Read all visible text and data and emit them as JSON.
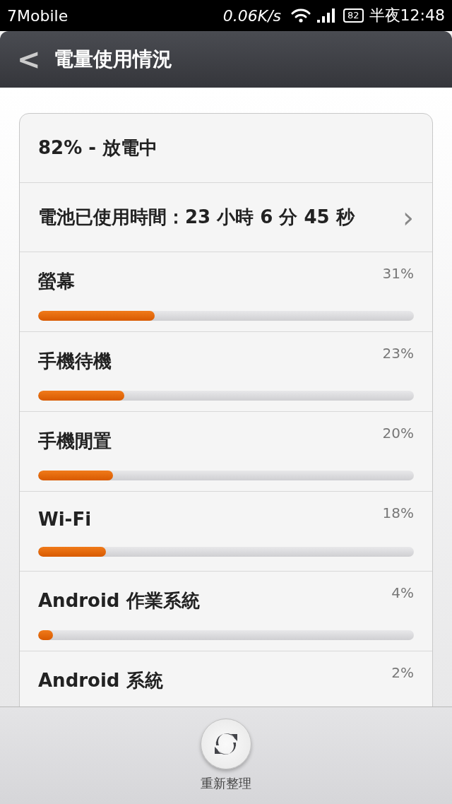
{
  "status_bar": {
    "carrier": "7Mobile",
    "speed": "0.06K/s",
    "battery": "82",
    "time": "半夜12:48"
  },
  "header": {
    "back": "<",
    "title": "電量使用情況"
  },
  "summary": {
    "status": "82% - 放電中",
    "usage_time": "電池已使用時間：23 小時 6 分 45 秒",
    "chevron": "›"
  },
  "items": [
    {
      "name": "螢幕",
      "percent": "31%",
      "level": 0.31
    },
    {
      "name": "手機待機",
      "percent": "23%",
      "level": 0.23
    },
    {
      "name": "手機閒置",
      "percent": "20%",
      "level": 0.2
    },
    {
      "name": "Wi-Fi",
      "percent": "18%",
      "level": 0.18
    },
    {
      "name": "Android 作業系統",
      "percent": "4%",
      "level": 0.04
    },
    {
      "name": "Android 系統",
      "percent": "2%"
    }
  ],
  "refresh": {
    "label": "重新整理"
  }
}
